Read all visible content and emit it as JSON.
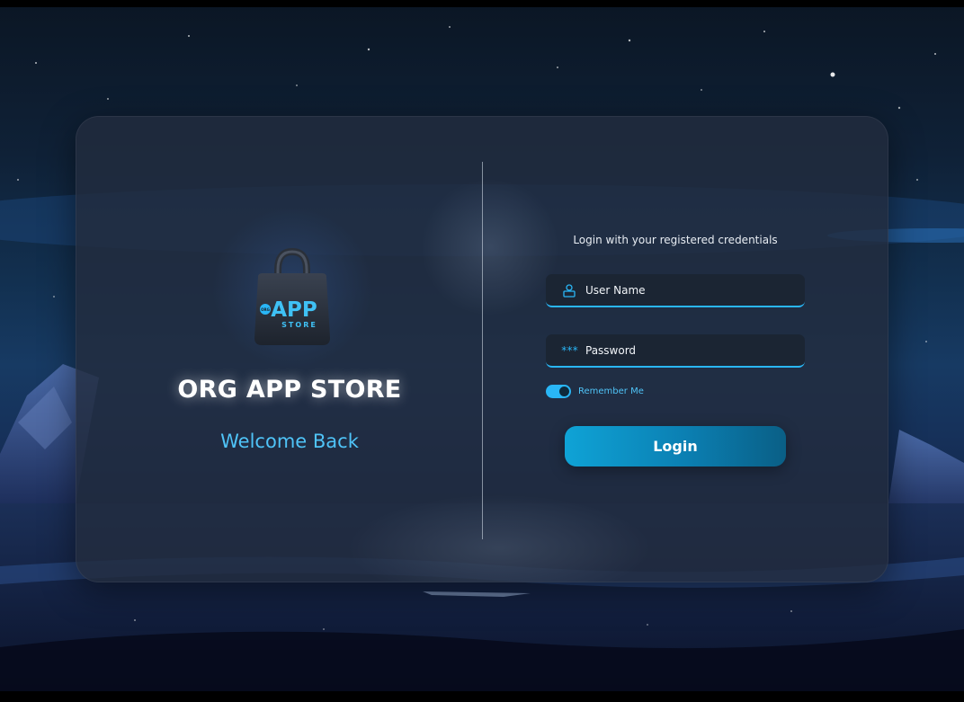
{
  "app": {
    "logo": {
      "name": "app-store-bag-logo",
      "text_main": "APP",
      "text_sub": "STORE",
      "text_tag": "ORG"
    },
    "title": "ORG APP STORE",
    "subtitle": "Welcome Back"
  },
  "login": {
    "caption": "Login with your registered credentials",
    "username": {
      "placeholder": "User Name",
      "value": "",
      "icon": "user-icon"
    },
    "password": {
      "placeholder": "Password",
      "value": "",
      "icon": "password-asterisks-icon",
      "icon_glyph": "***"
    },
    "remember": {
      "label": "Remember Me",
      "checked": true
    },
    "submit_label": "Login"
  },
  "colors": {
    "accent": "#29b6f6",
    "accent_text": "#4fc3f7",
    "card": "#222c3e",
    "field_bg": "#1b2533",
    "button_start": "#0fa3d6",
    "button_end": "#0a5f86"
  }
}
